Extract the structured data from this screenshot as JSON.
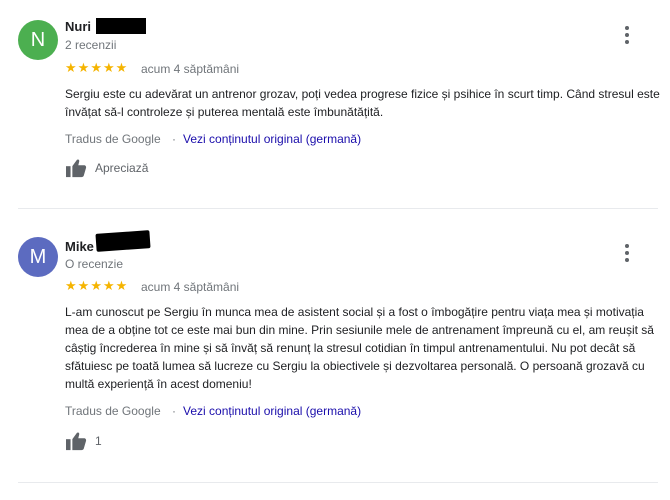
{
  "reviews": [
    {
      "avatar_letter": "N",
      "avatar_color": "#4caf50",
      "name": "Nuri",
      "review_count": "2 recenzii",
      "rating": 5,
      "stars": "★★★★★",
      "date": "acum 4 săptămâni",
      "text": "Sergiu este cu adevărat un antrenor grozav, poți vedea progrese fizice și psihice în scurt timp. Când stresul este învățat să-l controleze și puterea mentală este îmbunătățită.",
      "translated_by": "Tradus de Google",
      "separator": "·",
      "original_link": "Vezi conținutul original (germană)",
      "like_label": "Apreciază"
    },
    {
      "avatar_letter": "M",
      "avatar_color": "#5c6bc0",
      "name": "Mike",
      "review_count": "O recenzie",
      "rating": 5,
      "stars": "★★★★★",
      "date": "acum 4 săptămâni",
      "text": "L-am cunoscut pe Sergiu în munca mea de asistent social și a fost o îmbogățire pentru viața mea și motivația mea de a obține tot ce este mai bun din mine. Prin sesiunile mele de antrenament împreună cu el, am reușit să câștig încrederea în mine și să învăț să renunț la stresul cotidian în timpul antrenamentului. Nu pot decât să sfătuiesc pe toată lumea să lucreze cu Sergiu la obiectivele și dezvoltarea personală. O persoană grozavă cu multă experiență în acest domeniu!",
      "translated_by": "Tradus de Google",
      "separator": "·",
      "original_link": "Vezi conținutul original (germană)",
      "like_label": "1"
    }
  ],
  "icons": {
    "more": "more-vert-icon",
    "like": "thumb-up-icon"
  }
}
